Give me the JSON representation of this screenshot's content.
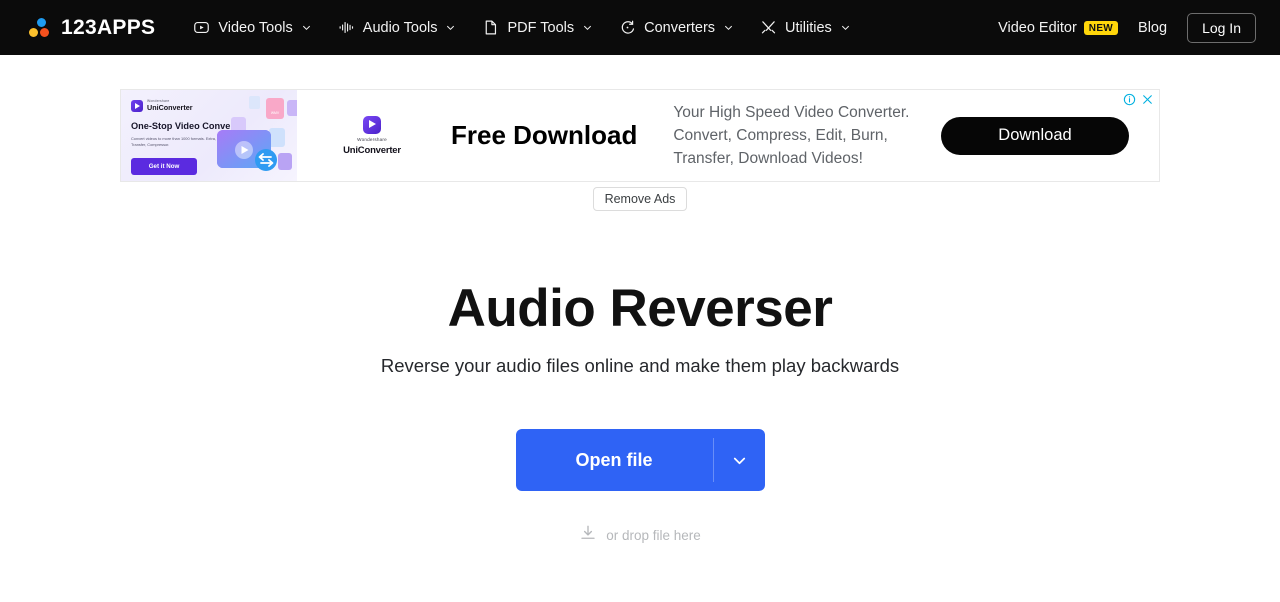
{
  "navbar": {
    "logo": {
      "text": "123APPS",
      "dots": [
        "#1e9bf0",
        "#fbc02d",
        "#f4511e"
      ]
    },
    "items": [
      {
        "label": "Video Tools",
        "icon": "play-icon"
      },
      {
        "label": "Audio Tools",
        "icon": "waveform-icon"
      },
      {
        "label": "PDF Tools",
        "icon": "document-icon"
      },
      {
        "label": "Converters",
        "icon": "refresh-icon"
      },
      {
        "label": "Utilities",
        "icon": "tools-icon"
      }
    ],
    "video_editor": {
      "label": "Video Editor",
      "badge": "NEW"
    },
    "blog": "Blog",
    "login": "Log In",
    "background": "#0b0b0b",
    "badge_color": "#ffd60a"
  },
  "ad": {
    "creative": {
      "brand_small": "Wondershare",
      "brand": "UniConverter",
      "headline": "One-Stop Video Converter",
      "subtext": "Convert videos to more than 1000 formats. Extra, Recorder, Transfer, Compressor.",
      "cta": "Get it Now"
    },
    "logo_line1": "Wondershare",
    "logo_line2": "UniConverter",
    "headline": "Free Download",
    "copy": "Your High Speed Video Converter.\nConvert, Compress, Edit, Burn,\nTransfer, Download Videos!",
    "download_label": "Download",
    "info_icon": "info-icon",
    "close_icon": "close-icon",
    "corner_icon_color": "#00b0e0",
    "remove_ads": "Remove Ads"
  },
  "main": {
    "title": "Audio Reverser",
    "subtitle": "Reverse your audio files online and make them play backwards",
    "open_file": "Open file",
    "open_caret_icon": "chevron-down-icon",
    "drop_hint": "or drop file here",
    "drop_icon": "download-arrow-icon",
    "accent": "#2f63f5"
  }
}
